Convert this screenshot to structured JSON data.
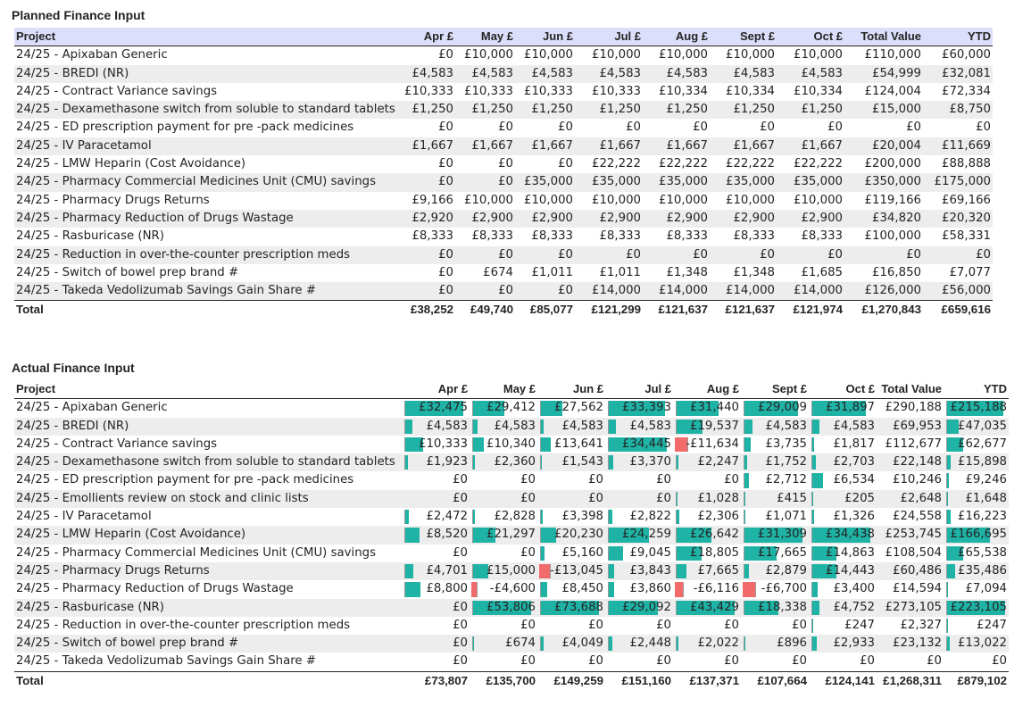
{
  "planned": {
    "title": "Planned Finance Input",
    "headers": [
      "Project",
      "Apr £",
      "May £",
      "Jun £",
      "Jul £",
      "Aug £",
      "Sept £",
      "Oct £",
      "Total Value",
      "YTD"
    ],
    "header_bg": "#dcdffb",
    "rows": [
      [
        "24/25 - Apixaban Generic",
        "£0",
        "£10,000",
        "£10,000",
        "£10,000",
        "£10,000",
        "£10,000",
        "£10,000",
        "£110,000",
        "£60,000"
      ],
      [
        "24/25 - BREDI (NR)",
        "£4,583",
        "£4,583",
        "£4,583",
        "£4,583",
        "£4,583",
        "£4,583",
        "£4,583",
        "£54,999",
        "£32,081"
      ],
      [
        "24/25 - Contract Variance savings",
        "£10,333",
        "£10,333",
        "£10,333",
        "£10,333",
        "£10,334",
        "£10,334",
        "£10,334",
        "£124,004",
        "£72,334"
      ],
      [
        "24/25 - Dexamethasone switch from soluble to standard tablets",
        "£1,250",
        "£1,250",
        "£1,250",
        "£1,250",
        "£1,250",
        "£1,250",
        "£1,250",
        "£15,000",
        "£8,750"
      ],
      [
        "24/25 - ED prescription payment for pre -pack medicines",
        "£0",
        "£0",
        "£0",
        "£0",
        "£0",
        "£0",
        "£0",
        "£0",
        "£0"
      ],
      [
        "24/25 - IV Paracetamol",
        "£1,667",
        "£1,667",
        "£1,667",
        "£1,667",
        "£1,667",
        "£1,667",
        "£1,667",
        "£20,004",
        "£11,669"
      ],
      [
        "24/25 - LMW Heparin (Cost Avoidance)",
        "£0",
        "£0",
        "£0",
        "£22,222",
        "£22,222",
        "£22,222",
        "£22,222",
        "£200,000",
        "£88,888"
      ],
      [
        "24/25 - Pharmacy Commercial Medicines Unit (CMU) savings",
        "£0",
        "£0",
        "£35,000",
        "£35,000",
        "£35,000",
        "£35,000",
        "£35,000",
        "£350,000",
        "£175,000"
      ],
      [
        "24/25 - Pharmacy Drugs Returns",
        "£9,166",
        "£10,000",
        "£10,000",
        "£10,000",
        "£10,000",
        "£10,000",
        "£10,000",
        "£119,166",
        "£69,166"
      ],
      [
        "24/25 - Pharmacy Reduction of Drugs Wastage",
        "£2,920",
        "£2,900",
        "£2,900",
        "£2,900",
        "£2,900",
        "£2,900",
        "£2,900",
        "£34,820",
        "£20,320"
      ],
      [
        "24/25 - Rasburicase (NR)",
        "£8,333",
        "£8,333",
        "£8,333",
        "£8,333",
        "£8,333",
        "£8,333",
        "£8,333",
        "£100,000",
        "£58,331"
      ],
      [
        "24/25 - Reduction in over-the-counter prescription meds",
        "£0",
        "£0",
        "£0",
        "£0",
        "£0",
        "£0",
        "£0",
        "£0",
        "£0"
      ],
      [
        "24/25 - Switch of bowel prep brand #",
        "£0",
        "£674",
        "£1,011",
        "£1,011",
        "£1,348",
        "£1,348",
        "£1,685",
        "£16,850",
        "£7,077"
      ],
      [
        "24/25 - Takeda Vedolizumab Savings Gain Share #",
        "£0",
        "£0",
        "£0",
        "£14,000",
        "£14,000",
        "£14,000",
        "£14,000",
        "£126,000",
        "£56,000"
      ]
    ],
    "total": [
      "Total",
      "£38,252",
      "£49,740",
      "£85,077",
      "£121,299",
      "£121,637",
      "£121,637",
      "£121,974",
      "£1,270,843",
      "£659,616"
    ]
  },
  "actual": {
    "title": "Actual Finance Input",
    "headers": [
      "Project",
      "Apr £",
      "May £",
      "Jun £",
      "Jul £",
      "Aug £",
      "Sept £",
      "Oct £",
      "Total Value",
      "YTD"
    ],
    "bar_pos_color": "#1fb3a6",
    "bar_neg_color": "#f26b6b",
    "rows": [
      [
        "24/25 - Apixaban Generic",
        "£32,475",
        "£29,412",
        "£27,562",
        "£33,393",
        "£31,440",
        "£29,009",
        "£31,897",
        "£290,188",
        "£215,188"
      ],
      [
        "24/25 - BREDI (NR)",
        "£4,583",
        "£4,583",
        "£4,583",
        "£4,583",
        "£19,537",
        "£4,583",
        "£4,583",
        "£69,953",
        "£47,035"
      ],
      [
        "24/25 - Contract Variance savings",
        "£10,333",
        "£10,340",
        "£13,641",
        "£34,445",
        "-£11,634",
        "£3,735",
        "£1,817",
        "£112,677",
        "£62,677"
      ],
      [
        "24/25 - Dexamethasone switch from soluble to standard tablets",
        "£1,923",
        "£2,360",
        "£1,543",
        "£3,370",
        "£2,247",
        "£1,752",
        "£2,703",
        "£22,148",
        "£15,898"
      ],
      [
        "24/25 - ED prescription payment for pre -pack medicines",
        "£0",
        "£0",
        "£0",
        "£0",
        "£0",
        "£2,712",
        "£6,534",
        "£10,246",
        "£9,246"
      ],
      [
        "24/25 - Emollients review on stock and clinic lists",
        "£0",
        "£0",
        "£0",
        "£0",
        "£1,028",
        "£415",
        "£205",
        "£2,648",
        "£1,648"
      ],
      [
        "24/25 - IV Paracetamol",
        "£2,472",
        "£2,828",
        "£3,398",
        "£2,822",
        "£2,306",
        "£1,071",
        "£1,326",
        "£24,558",
        "£16,223"
      ],
      [
        "24/25 - LMW Heparin (Cost Avoidance)",
        "£8,520",
        "£21,297",
        "£20,230",
        "£24,259",
        "£26,642",
        "£31,309",
        "£34,438",
        "£253,745",
        "£166,695"
      ],
      [
        "24/25 - Pharmacy Commercial Medicines Unit (CMU) savings",
        "£0",
        "£0",
        "£5,160",
        "£9,045",
        "£18,805",
        "£17,665",
        "£14,863",
        "£108,504",
        "£65,538"
      ],
      [
        "24/25 - Pharmacy Drugs Returns",
        "£4,701",
        "£15,000",
        "-£13,045",
        "£3,843",
        "£7,665",
        "£2,879",
        "£14,443",
        "£60,486",
        "£35,486"
      ],
      [
        "24/25 - Pharmacy Reduction of Drugs Wastage",
        "£8,800",
        "-£4,600",
        "£8,450",
        "£3,860",
        "-£6,116",
        "-£6,700",
        "£3,400",
        "£14,594",
        "£7,094"
      ],
      [
        "24/25 - Rasburicase (NR)",
        "£0",
        "£53,806",
        "£73,688",
        "£29,092",
        "£43,429",
        "£18,338",
        "£4,752",
        "£273,105",
        "£223,105"
      ],
      [
        "24/25 - Reduction in over-the-counter prescription meds",
        "£0",
        "£0",
        "£0",
        "£0",
        "£0",
        "£0",
        "£247",
        "£2,327",
        "£247"
      ],
      [
        "24/25 - Switch of bowel prep brand #",
        "£0",
        "£674",
        "£4,049",
        "£2,448",
        "£2,022",
        "£896",
        "£2,933",
        "£23,132",
        "£13,022"
      ],
      [
        "24/25 - Takeda Vedolizumab Savings Gain Share #",
        "£0",
        "£0",
        "£0",
        "£0",
        "£0",
        "£0",
        "£0",
        "£0",
        "£0"
      ]
    ],
    "total": [
      "Total",
      "£73,807",
      "£135,700",
      "£149,259",
      "£151,160",
      "£137,371",
      "£107,664",
      "£124,141",
      "£1,268,311",
      "£879,102"
    ]
  }
}
